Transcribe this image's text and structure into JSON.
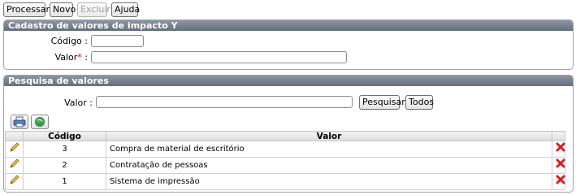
{
  "toolbar": {
    "processar": "Processar",
    "novo": "Novo",
    "excluir": "Excluir",
    "ajuda": "Ajuda"
  },
  "cadastro": {
    "title": "Cadastro de valores de impacto Y",
    "codigo_label": "Código :",
    "codigo_value": "",
    "valor_label": "Valor",
    "required_mark": "*",
    "valor_colon": " :",
    "valor_value": ""
  },
  "pesquisa": {
    "title": "Pesquisa de valores",
    "valor_label": "Valor :",
    "valor_value": "",
    "pesquisar": "Pesquisar",
    "todos": "Todos"
  },
  "table": {
    "columns": [
      "Código",
      "Valor"
    ],
    "rows": [
      {
        "codigo": "3",
        "valor": "Compra de material de escritório"
      },
      {
        "codigo": "2",
        "valor": "Contratação de pessoas"
      },
      {
        "codigo": "1",
        "valor": "Sistema de impressão"
      }
    ]
  },
  "icons": {
    "print": "printer-icon",
    "refresh": "globe-refresh-icon",
    "edit": "pencil-edit-icon",
    "delete": "red-x-delete-icon"
  },
  "colors": {
    "panel_header": "#65707d",
    "required": "#d00000",
    "delete": "#d42020"
  }
}
